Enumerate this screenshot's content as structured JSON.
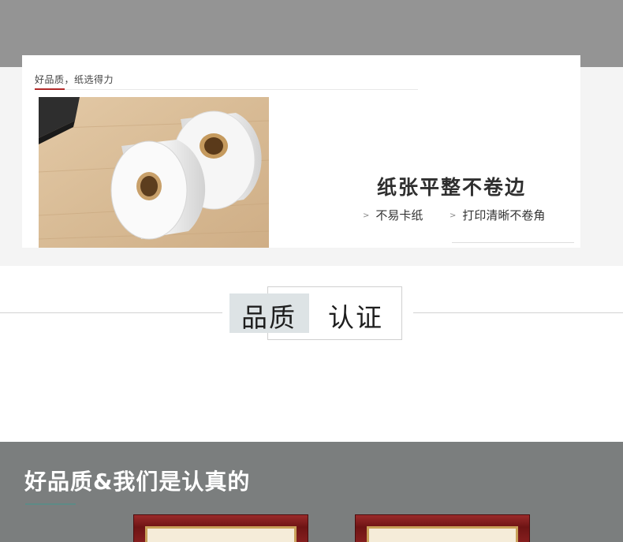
{
  "card": {
    "tagline": "好品质，纸选得力",
    "feature_title": "纸张平整不卷边",
    "features": [
      "不易卡纸",
      "打印清晰不卷角"
    ],
    "feature_chevron": ">"
  },
  "certification": {
    "word_1": "品质",
    "word_2": "认证"
  },
  "bottom": {
    "heading": "好品质&我们是认真的"
  }
}
